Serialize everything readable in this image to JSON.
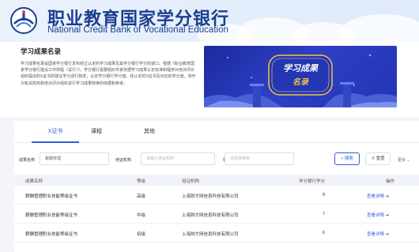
{
  "header": {
    "brand_cn": "职业教育国家学分银行",
    "brand_en": "National Credit Bank of Vocational Education"
  },
  "intro": {
    "title": "学习成果名录",
    "text": "学习成果名录是国家学分银行发布经过认定的学习成果及其学分银行学分的窗口。根据《职业教育国家学分银行建设工作规程（试行）》，学分银行需要组织专家依据学习成果认定标准和程序对培训评价组织提出的X证书的建议学分进行核定，认定学分银行学分值。经认定的X证书及对应的学分值，将作为有关院校和培训评价组织进行学习成果转换的依据和参考。",
    "banner_text_1": "学习成果",
    "banner_text_2": "名录"
  },
  "tabs": [
    {
      "label": "X证书",
      "active": true
    },
    {
      "label": "课程",
      "active": false
    },
    {
      "label": "其他",
      "active": false
    }
  ],
  "filters": {
    "name_label": "成果名称",
    "name_value": "薪酬管理",
    "org_label": "培证机构",
    "org_placeholder": "请输入培证机构",
    "level_label": "等级",
    "level_placeholder": "请选择等级",
    "search_label": "搜索",
    "reset_label": "重置",
    "more_label": "更多"
  },
  "table": {
    "headers": [
      "成果名称",
      "等级",
      "培证机构",
      "学分银行学分",
      "操作"
    ],
    "rows": [
      {
        "name": "薪酬管理职业技能等级证书",
        "level": "高级",
        "org": "上海财才网信息科技有限公司",
        "credit": "8",
        "action": "查看详情 ➔"
      },
      {
        "name": "薪酬管理职业技能等级证书",
        "level": "中级",
        "org": "上海财才网信息科技有限公司",
        "credit": "7",
        "action": "查看详情 ➔"
      },
      {
        "name": "薪酬管理职业技能等级证书",
        "level": "初级",
        "org": "上海财才网信息科技有限公司",
        "credit": "6",
        "action": "查看详情 ➔"
      }
    ]
  },
  "colors": {
    "brand_blue": "#1b3f8f",
    "accent": "#2f5fd6",
    "banner_bg": "#2436b4",
    "banner_gold": "#f2c53d"
  },
  "icons": [
    "logo-icon",
    "search-icon",
    "reset-icon",
    "arrow-right-icon"
  ]
}
